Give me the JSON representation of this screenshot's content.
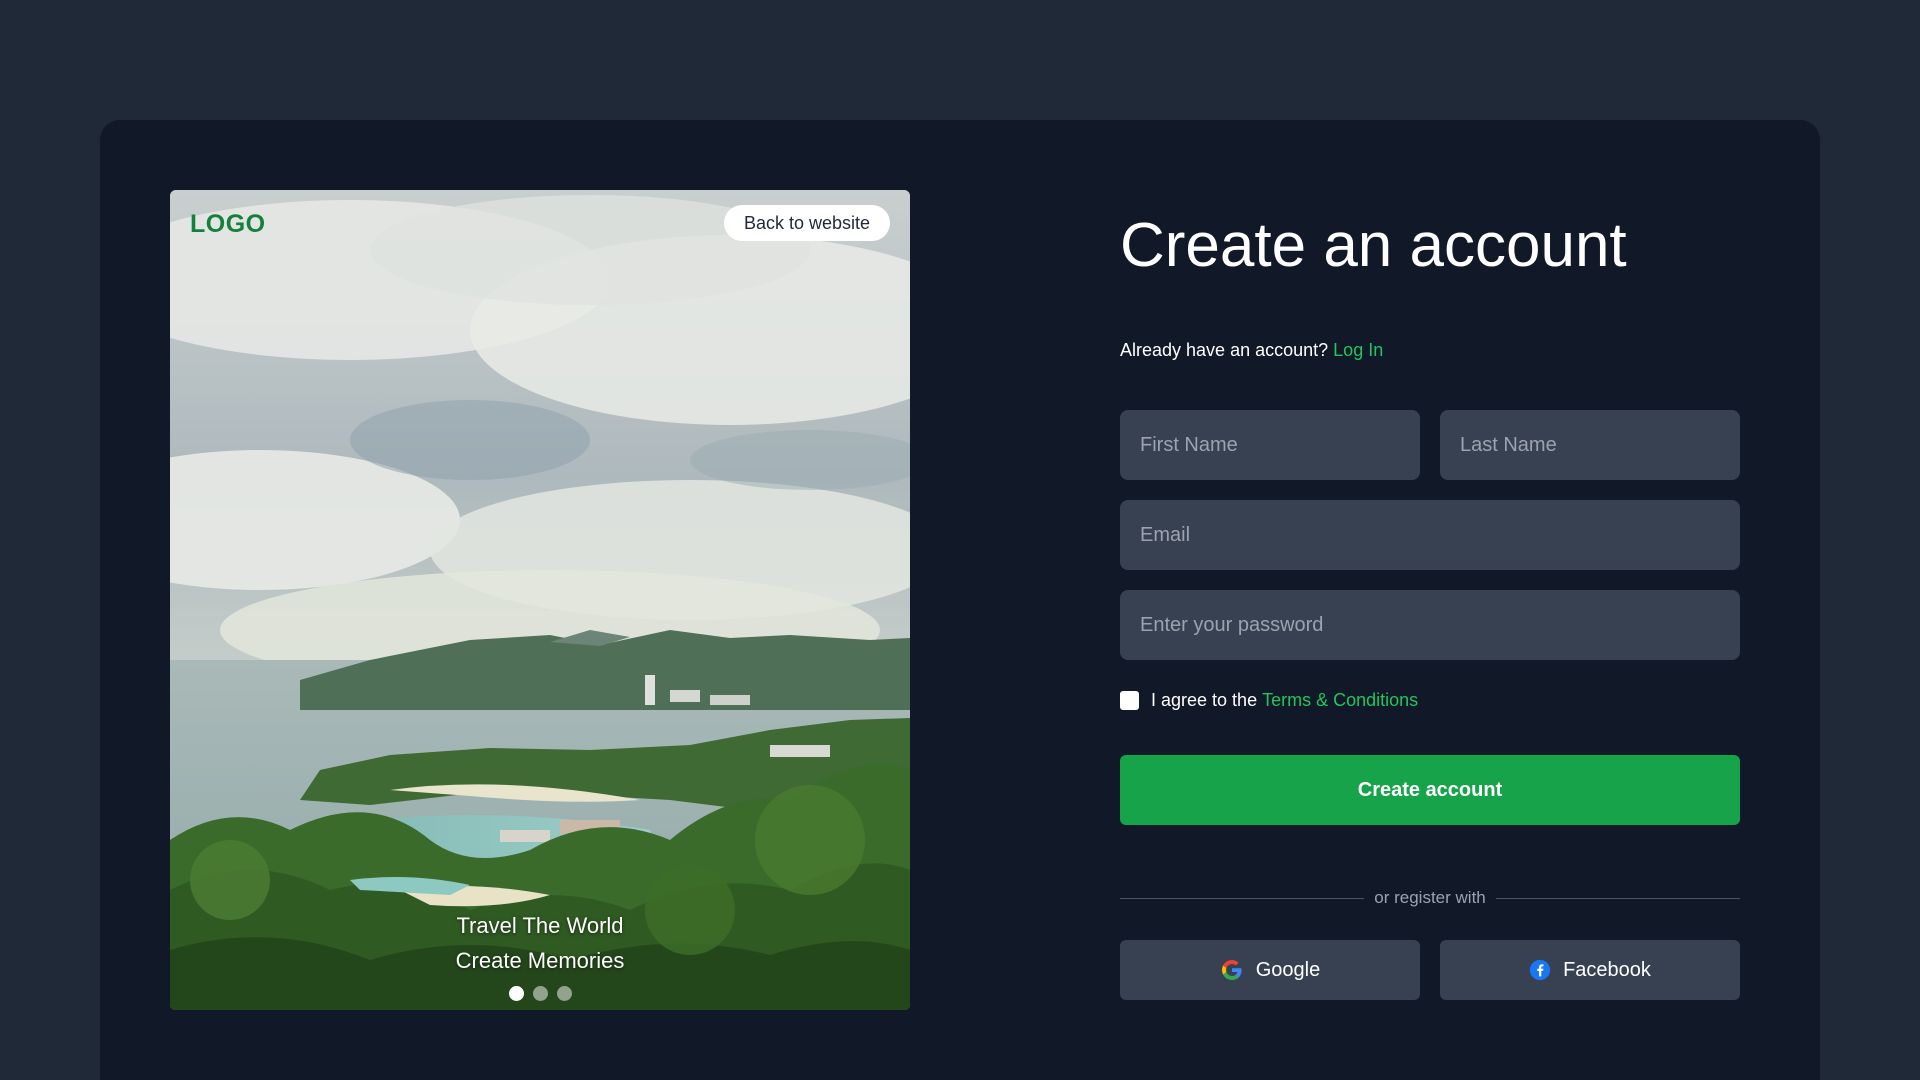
{
  "hero": {
    "logo": "LOGO",
    "back_button": "Back to website",
    "tagline_line1": "Travel The World",
    "tagline_line2": "Create Memories",
    "carousel": {
      "slide_count": 3,
      "active_index": 0
    }
  },
  "form": {
    "title": "Create an account",
    "have_account_text": "Already have an account?",
    "login_link": "Log In",
    "first_name": {
      "placeholder": "First Name",
      "value": ""
    },
    "last_name": {
      "placeholder": "Last Name",
      "value": ""
    },
    "email": {
      "placeholder": "Email",
      "value": ""
    },
    "password": {
      "placeholder": "Enter your password",
      "value": ""
    },
    "agree_prefix": "I agree to the",
    "terms_link": "Terms & Conditions",
    "agree_checked": false,
    "submit_label": "Create account",
    "divider_text": "or register with",
    "google_label": "Google",
    "facebook_label": "Facebook"
  },
  "colors": {
    "page_bg": "#1f2937",
    "card_bg": "#111827",
    "input_bg": "#374151",
    "accent_green": "#16a34a",
    "link_green": "#22c55e",
    "logo_green": "#15803d"
  },
  "icons": {
    "google": "google-icon",
    "facebook": "facebook-icon"
  }
}
